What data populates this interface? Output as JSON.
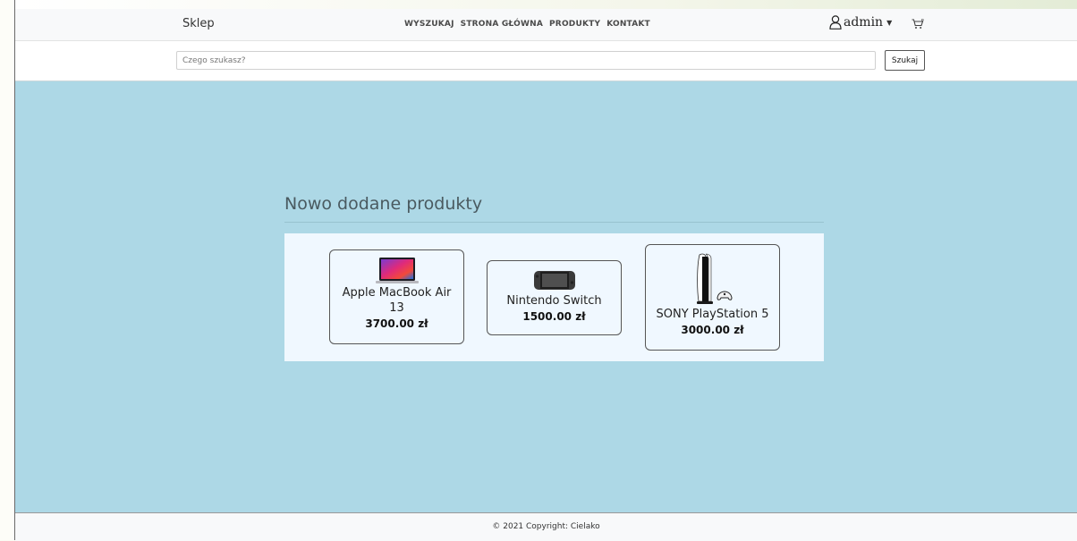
{
  "navbar": {
    "brand": "Sklep",
    "links": [
      "WYSZUKAJ",
      "STRONA GŁÓWNA",
      "PRODUKTY",
      "KONTAKT"
    ],
    "user": "admin",
    "icons": {
      "user": "user-icon",
      "caret": "caret-down-icon",
      "cart": "cart-icon"
    }
  },
  "search": {
    "placeholder": "Czego szukasz?",
    "value": "",
    "button": "Szukaj"
  },
  "main": {
    "title": "Nowo dodane produkty",
    "products": [
      {
        "name": "Apple MacBook Air 13",
        "price": "3700.00 zł",
        "image": "macbook-image"
      },
      {
        "name": "Nintendo Switch",
        "price": "1500.00 zł",
        "image": "nintendo-switch-image"
      },
      {
        "name": "SONY PlayStation 5",
        "price": "3000.00 zł",
        "image": "playstation-image"
      }
    ]
  },
  "footer": {
    "prefix": "© 2021 Copyright: ",
    "author": "Cielako"
  },
  "colors": {
    "page_background": "#add8e6",
    "navbar_background": "#f8f9fa",
    "products_background": "#f0f8ff"
  }
}
